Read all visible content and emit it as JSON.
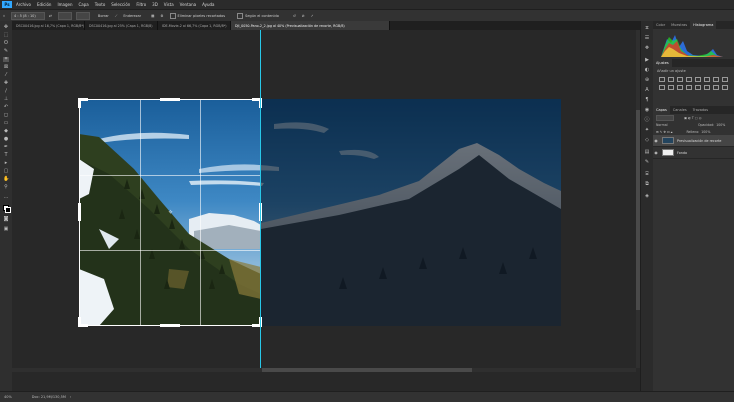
{
  "app": {
    "logo": "Ps"
  },
  "menu": [
    "Archivo",
    "Edición",
    "Imagen",
    "Capa",
    "Texto",
    "Selección",
    "Filtro",
    "3D",
    "Vista",
    "Ventana",
    "Ayuda"
  ],
  "options": {
    "ratio": "4 : 5 (8 : 10)",
    "borrar": "Borrar",
    "enderezar": "Enderezar",
    "eliminar_pixeles": "Eliminar píxeles recortados",
    "segun_contenido": "Según el contenido"
  },
  "tabs": [
    {
      "label": "DSC00416.jpg al 16,7% (Capa 1, RGB/8*)",
      "active": false
    },
    {
      "label": "DSC00416.jpg al 25% (Capa 1, RGB/8)",
      "active": false
    },
    {
      "label": "IDE-Movie-2 al 66,7% (Capa 1, RGB/8*)",
      "active": false
    },
    {
      "label": "DJI_0050-Pano-2_2.jpg al 40% (Previsualización de recorte, RGB/8)",
      "active": true
    }
  ],
  "status": {
    "zoom": "40%",
    "doc": "Doc: 21,9M/130,5M"
  },
  "panel_tabs_top": [
    {
      "label": "Color",
      "active": false
    },
    {
      "label": "Muestras",
      "active": false
    },
    {
      "label": "Histograma",
      "active": true
    }
  ],
  "adjustments": {
    "tab": "Ajustes",
    "add_label": "Añadir un ajuste"
  },
  "panel_tabs_layers": [
    {
      "label": "Capas",
      "active": true
    },
    {
      "label": "Canales",
      "active": false
    },
    {
      "label": "Trazados",
      "active": false
    }
  ],
  "layers_controls": {
    "blend_mode": "Normal",
    "opacity_label": "Opacidad:",
    "opacity_value": "100%",
    "fill_label": "Relleno:",
    "fill_value": "100%"
  },
  "layers": [
    {
      "name": "Previsualización de recorte",
      "selected": true
    },
    {
      "name": "Fondo",
      "selected": false
    }
  ],
  "colors": {
    "accent": "#31a8ff",
    "guide": "#28c7e8",
    "crop_border": "#ffffff"
  }
}
